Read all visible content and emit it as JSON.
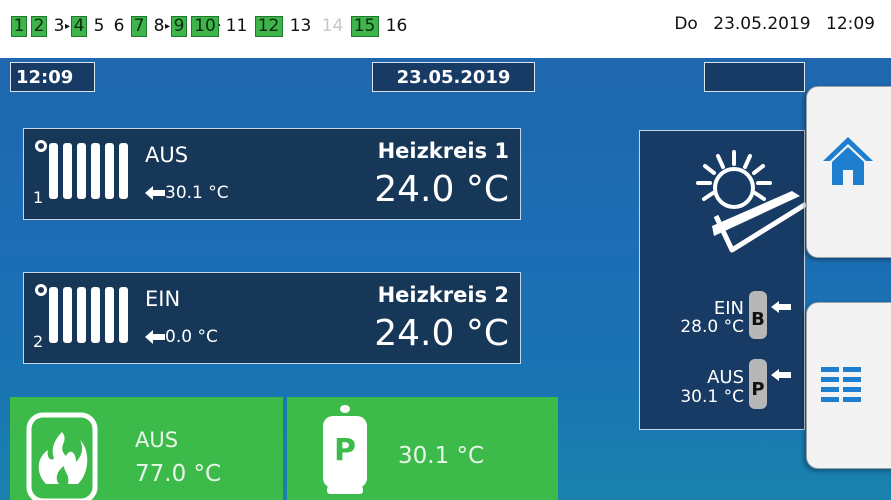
{
  "status_bar": {
    "outputs": [
      {
        "label": "1",
        "state": "on"
      },
      {
        "label": "2",
        "state": "on"
      },
      {
        "label": "3",
        "state": "off",
        "linked_next": "arrow"
      },
      {
        "label": "4",
        "state": "on"
      },
      {
        "label": "5",
        "state": "off"
      },
      {
        "label": "6",
        "state": "off"
      },
      {
        "label": "7",
        "state": "on"
      },
      {
        "label": "8",
        "state": "off",
        "linked_next": "arrow"
      },
      {
        "label": "9",
        "state": "on"
      },
      {
        "label": "10",
        "state": "on",
        "linked_next": "dot"
      },
      {
        "label": "11",
        "state": "off"
      },
      {
        "label": "12",
        "state": "on"
      },
      {
        "label": "13",
        "state": "off"
      },
      {
        "label": "14",
        "state": "disabled"
      },
      {
        "label": "15",
        "state": "on"
      },
      {
        "label": "16",
        "state": "off"
      }
    ],
    "weekday": "Do",
    "date": "23.05.2019",
    "time": "12:09"
  },
  "screen": {
    "time_box": "12:09",
    "date_box": "23.05.2019",
    "heating_circuits": [
      {
        "number": "1",
        "state": "AUS",
        "return_temp": "30.1 °C",
        "name": "Heizkreis 1",
        "temp": "24.0 °C"
      },
      {
        "number": "2",
        "state": "EIN",
        "return_temp": "0.0 °C",
        "name": "Heizkreis 2",
        "temp": "24.0 °C"
      }
    ],
    "boiler": {
      "state": "AUS",
      "temp": "77.0 °C",
      "icon": "flame-icon"
    },
    "buffer": {
      "label": "P",
      "temp": "30.1 °C",
      "icon": "buffer-tank-icon"
    },
    "solar": {
      "icon": "solar-collector-icon",
      "tank_b": {
        "state": "EIN",
        "temp": "28.0 °C",
        "label": "B"
      },
      "tank_p": {
        "state": "AUS",
        "temp": "30.1 °C",
        "label": "P"
      }
    },
    "nav": {
      "home_icon": "home-icon",
      "menu_icon": "menu-list-icon"
    },
    "colors": {
      "accent_green": "#3dbb4a",
      "panel_dark": "#173b64",
      "background_blue": "#1f6db1",
      "icon_blue": "#1e7fd0"
    }
  }
}
